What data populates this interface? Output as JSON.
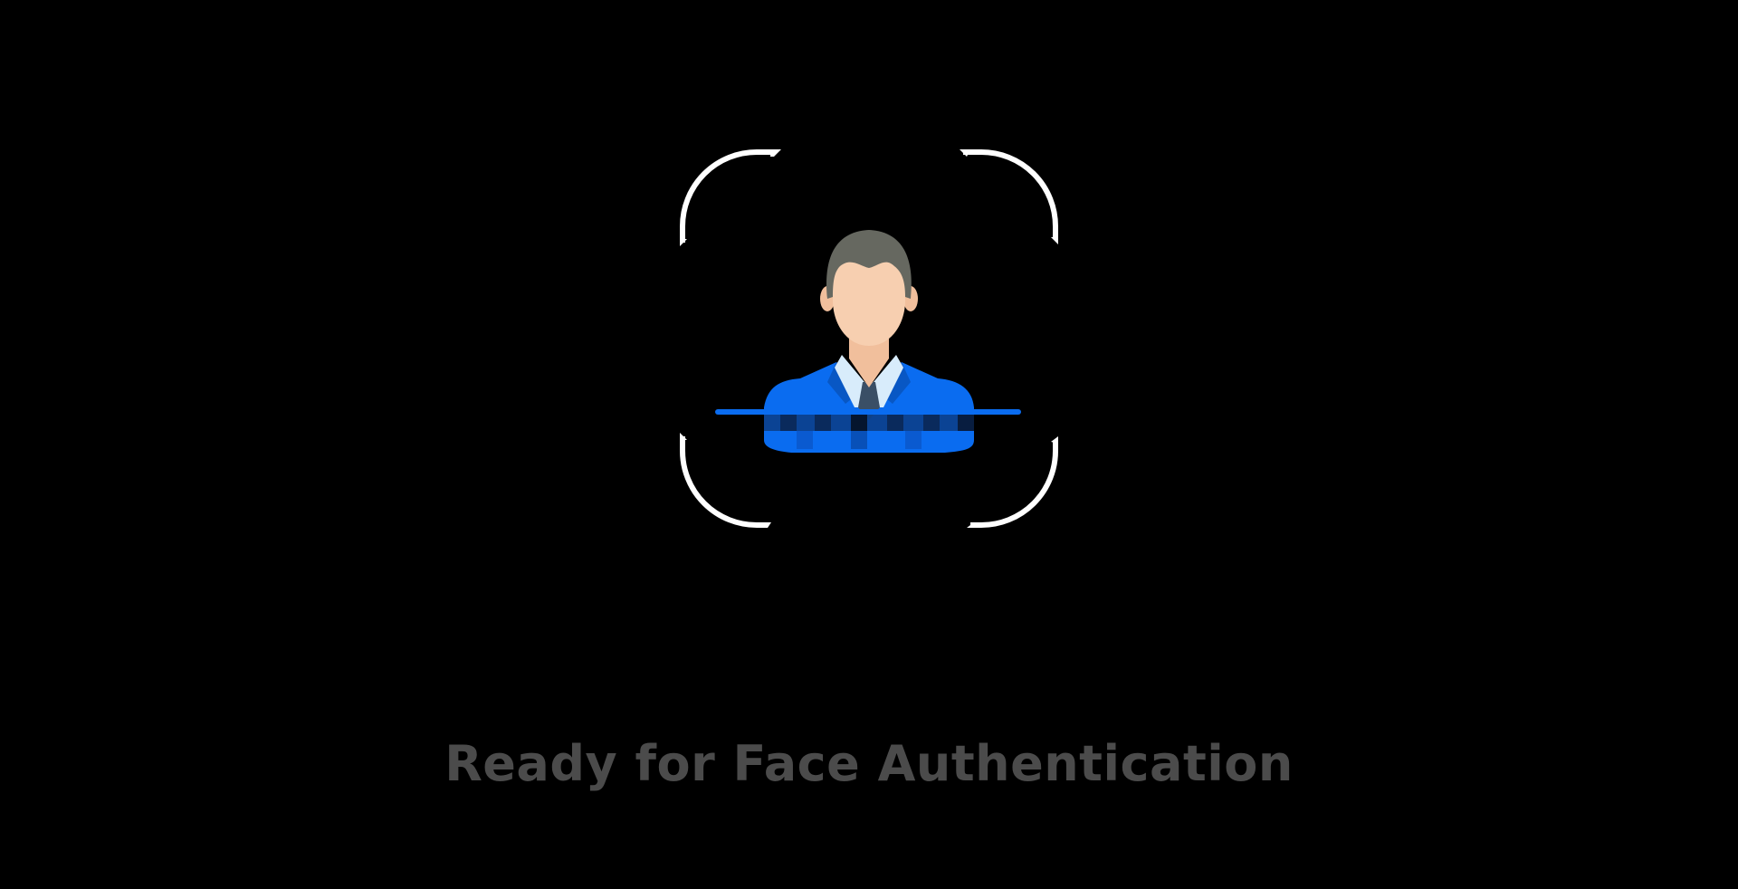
{
  "auth": {
    "status_text": "Ready for Face Authentication"
  },
  "icons": {
    "frame": "face-scan-frame-icon",
    "avatar": "user-avatar-icon",
    "scan_line": "scan-line"
  },
  "colors": {
    "background": "#000000",
    "frame": "#ffffff",
    "accent": "#0a6cf0",
    "status_text": "#4b4b4b",
    "hair": "#666860",
    "skin": "#f7cfb0",
    "shirt": "#d8ecfb",
    "tie": "#3a4f66"
  }
}
